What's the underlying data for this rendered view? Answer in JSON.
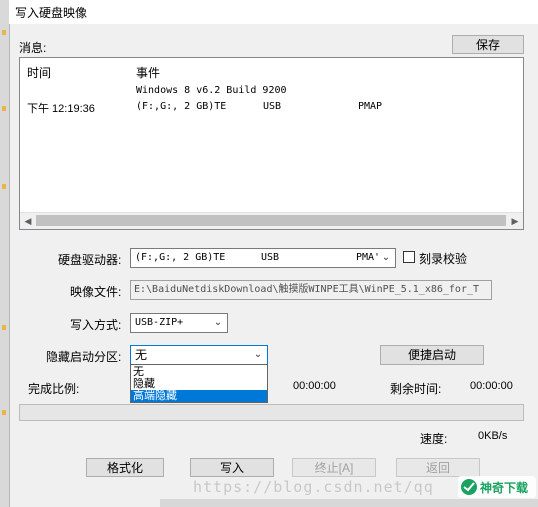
{
  "window": {
    "title": "写入硬盘映像"
  },
  "messages": {
    "label": "消息:",
    "save_label": "保存",
    "col_time": "时间",
    "col_event": "事件",
    "rows": [
      {
        "time": "",
        "event": "Windows 8 v6.2 Build 9200"
      },
      {
        "time": "下午 12:19:36",
        "event": "(F:,G:, 2 GB)TE",
        "c2": "USB",
        "c3": "PMAP"
      }
    ]
  },
  "form": {
    "drive_label": "硬盘驱动器:",
    "drive_value": "(F:,G:, 2 GB)TE",
    "drive_c2": "USB",
    "drive_c3": "PMA'",
    "verify_label": "刻录校验",
    "image_label": "映像文件:",
    "image_value": "E:\\BaiduNetdiskDownload\\触摸版WINPE工具\\WinPE_5.1_x86_for_T",
    "method_label": "写入方式:",
    "method_value": "USB-ZIP+",
    "hidden_label": "隐藏启动分区:",
    "hidden_value": "无",
    "hidden_options": [
      "无",
      "隐藏",
      "高端隐藏"
    ],
    "quick_boot_label": "便捷启动"
  },
  "progress": {
    "complete_label": "完成比例:",
    "elapsed": "00:00:00",
    "remaining_label": "剩余时间:",
    "remaining": "00:00:00",
    "value_fraction": 0,
    "speed_label": "速度:",
    "speed_value": "0KB/s"
  },
  "buttons": {
    "format": "格式化",
    "write": "写入",
    "stop": "终止[A]",
    "back": "返回"
  },
  "watermark": {
    "text": "https://blog.csdn.net/qq",
    "logo_text": "神奇下载"
  },
  "icons": {
    "verify_checkbox": "checkbox-icon",
    "dropdown": "chevron-down-icon"
  },
  "colors": {
    "selection": "#0078d7",
    "background": "#f0f0f0"
  }
}
